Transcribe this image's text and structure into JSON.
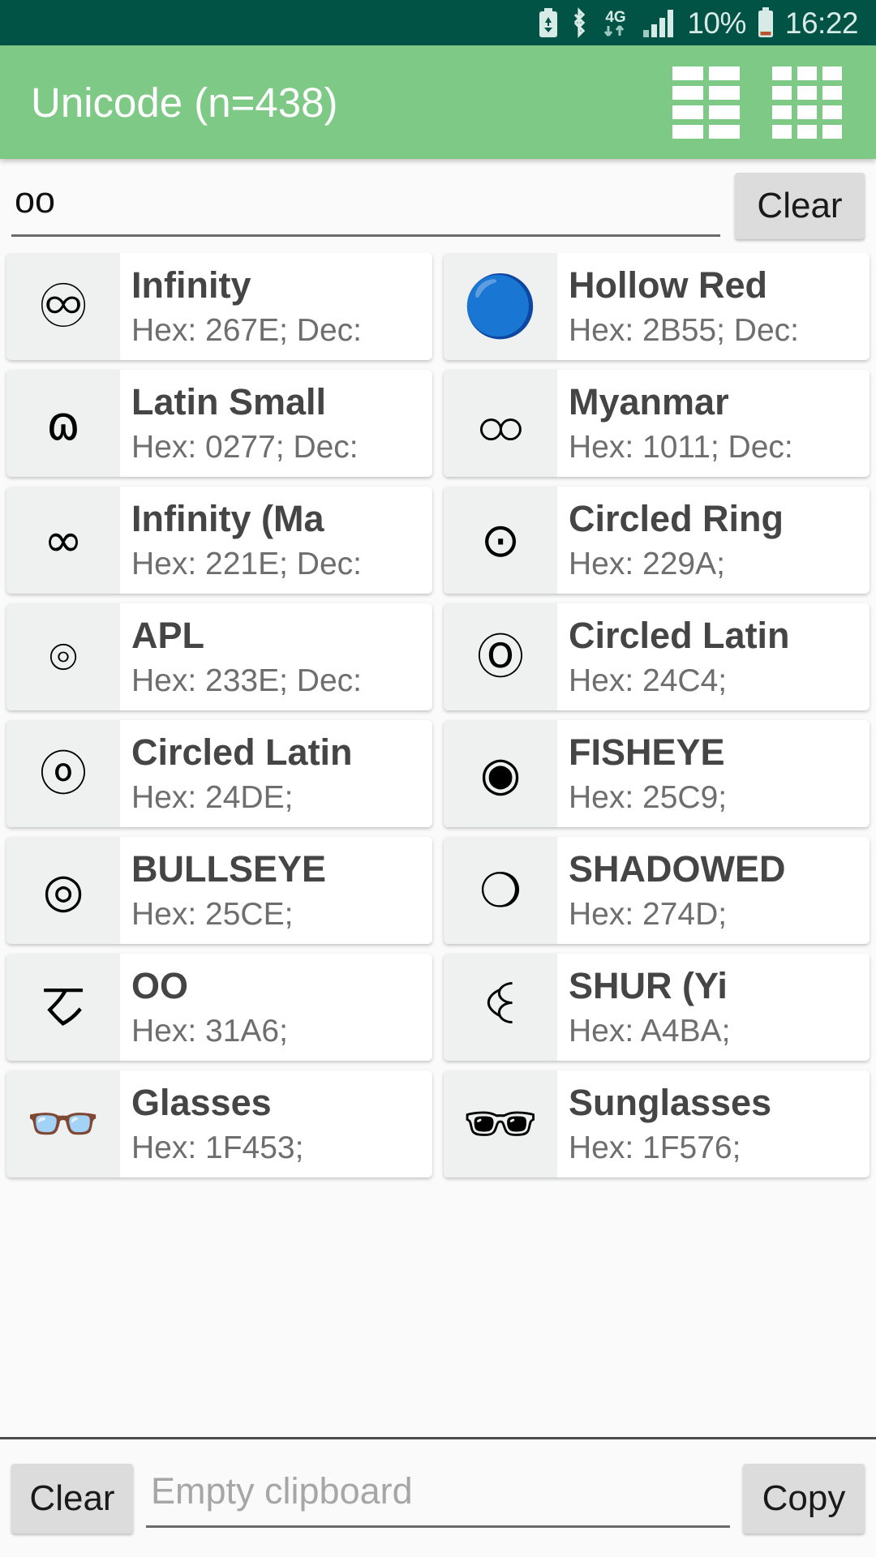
{
  "statusbar": {
    "icons": [
      "battery-saver-icon",
      "bluetooth-icon",
      "4g-data-icon",
      "signal-bars-icon",
      "battery-icon"
    ],
    "network_label": "4G",
    "battery_percent": "10%",
    "clock": "16:22"
  },
  "appbar": {
    "title": "Unicode (n=438)",
    "background": "#7ec986",
    "actions": [
      {
        "name": "view-two-column-icon"
      },
      {
        "name": "view-three-column-icon"
      }
    ]
  },
  "search": {
    "value": "oo",
    "placeholder": "",
    "clear_label": "Clear"
  },
  "list": {
    "rows": [
      [
        {
          "glyph": "♾",
          "glyph_kind": "emoji",
          "title": "Infinity",
          "sub": "Hex: 267E; Dec:"
        },
        {
          "glyph": "🔵",
          "glyph_kind": "emoji",
          "title": "Hollow Red",
          "sub": "Hex: 2B55; Dec:"
        }
      ],
      [
        {
          "glyph": "ɷ",
          "glyph_kind": "text",
          "title": "Latin Small",
          "sub": "Hex: 0277; Dec:"
        },
        {
          "glyph": "ထ",
          "glyph_kind": "text",
          "title": "Myanmar",
          "sub": "Hex: 1011; Dec:"
        }
      ],
      [
        {
          "glyph": "∞",
          "glyph_kind": "text",
          "title": "Infinity (Ma",
          "sub": "Hex: 221E; Dec:"
        },
        {
          "glyph": "⊙",
          "glyph_kind": "text",
          "title": "Circled Ring",
          "sub": "Hex: 229A;"
        }
      ],
      [
        {
          "glyph": "⌾",
          "glyph_kind": "text",
          "title": "APL",
          "sub": "Hex: 233E; Dec:"
        },
        {
          "glyph": "Ⓞ",
          "glyph_kind": "text",
          "title": "Circled Latin",
          "sub": "Hex: 24C4;"
        }
      ],
      [
        {
          "glyph": "ⓞ",
          "glyph_kind": "text",
          "title": "Circled Latin",
          "sub": "Hex: 24DE;"
        },
        {
          "glyph": "◉",
          "glyph_kind": "text",
          "title": "FISHEYE",
          "sub": "Hex: 25C9;"
        }
      ],
      [
        {
          "glyph": "◎",
          "glyph_kind": "text",
          "title": "BULLSEYE",
          "sub": "Hex: 25CE;"
        },
        {
          "glyph": "❍",
          "glyph_kind": "text",
          "title": "SHADOWED",
          "sub": "Hex: 274D;"
        }
      ],
      [
        {
          "glyph": "ㆦ",
          "glyph_kind": "text",
          "title": "OO",
          "sub": "Hex: 31A6;"
        },
        {
          "glyph": "ꒊ",
          "glyph_kind": "text",
          "title": "SHUR (Yi",
          "sub": "Hex: A4BA;"
        }
      ],
      [
        {
          "glyph": "👓",
          "glyph_kind": "emoji",
          "title": "Glasses",
          "sub": "Hex: 1F453;"
        },
        {
          "glyph": "🕶",
          "glyph_kind": "emoji",
          "title": "Sunglasses",
          "sub": "Hex: 1F576;"
        }
      ]
    ]
  },
  "bottombar": {
    "clear_label": "Clear",
    "clipboard_value": "",
    "clipboard_placeholder": "Empty clipboard",
    "copy_label": "Copy"
  }
}
